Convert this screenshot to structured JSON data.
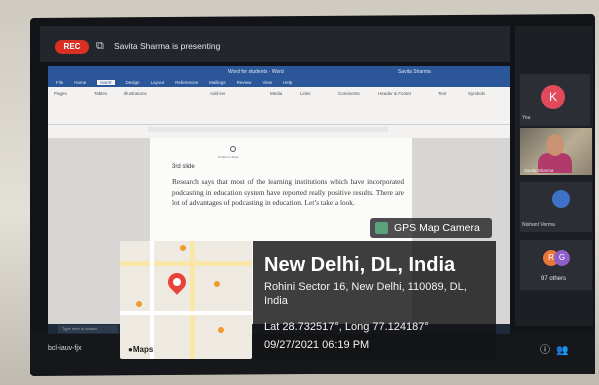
{
  "meet": {
    "rec_label": "REC",
    "presenting_text": "Savita Sharma is presenting",
    "meeting_code": "bcl-iauv-fjx"
  },
  "word": {
    "title": "Word for students · Word",
    "user": "Savita Sharma",
    "tabs": [
      "File",
      "Home",
      "Insert",
      "Design",
      "Layout",
      "References",
      "Mailings",
      "Review",
      "View",
      "Help"
    ],
    "active_tab": "Insert",
    "ribbon_groups": [
      "Pages",
      "Tables",
      "Illustrations",
      "Add-ins",
      "Media",
      "Links",
      "Comments",
      "Header & Footer",
      "Text",
      "Symbols"
    ],
    "pin_caption": "Profile for Meet",
    "slide_label": "3rd slide",
    "paragraph": "Research says that most of the learning institutions which have incorporated podcasting in education system have reported really positive results. There are lot of advantages of podcasting in education. Let’s take a look.",
    "search_placeholder": "Type here to search"
  },
  "participants": {
    "you_initial": "K",
    "you_label": "You",
    "presenter_name": "Savita Sharma",
    "nishant_label": "Nishant Verma",
    "others_initials": [
      "R",
      "G"
    ],
    "others_label": "97 others"
  },
  "gps": {
    "header": "GPS Map Camera",
    "city": "New Delhi, DL, India",
    "address": "Rohini Sector 16, New Delhi, 110089, DL, India",
    "coordinates": "Lat 28.732517°, Long 77.124187°",
    "datetime": "09/27/2021 06:19 PM",
    "maps_label": "Maps"
  },
  "colors": {
    "rec_red": "#d93025",
    "word_blue": "#2b579a",
    "avatar_pink": "#e04a5a",
    "pin_red": "#e8433a"
  }
}
